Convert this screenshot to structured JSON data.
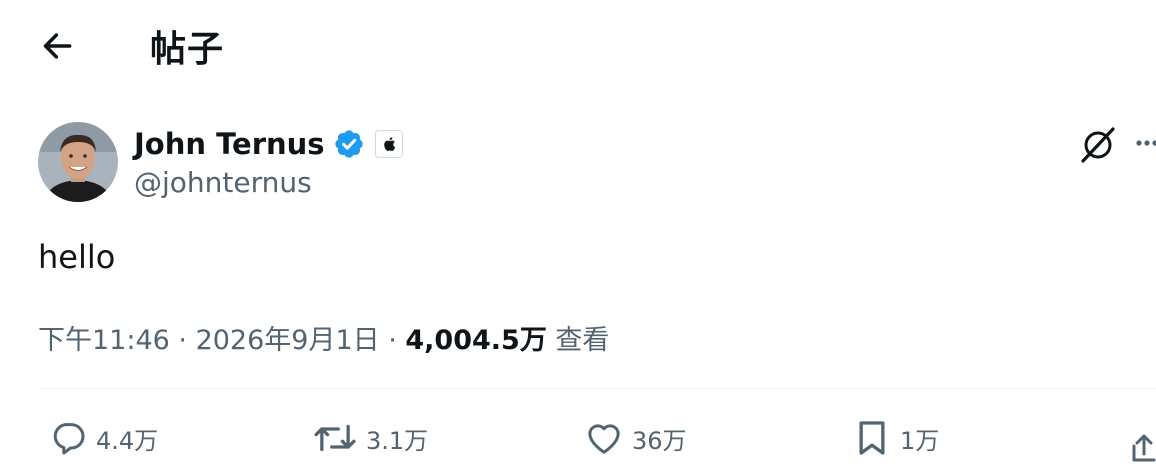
{
  "header": {
    "title": "帖子",
    "back_icon": "arrow-left-icon"
  },
  "author": {
    "name": "John Ternus",
    "handle": "@johnternus",
    "verified_color": "#1d9bf0",
    "affiliate_icon": "apple-icon"
  },
  "post": {
    "text": "hello",
    "time": "下午11:46",
    "sep1": " · ",
    "date": "2026年9月1日",
    "sep2": " · ",
    "views_count": "4,004.5万",
    "views_label": " 查看"
  },
  "actions": {
    "reply_count": "4.4万",
    "repost_count": "3.1万",
    "like_count": "36万",
    "bookmark_count": "1万"
  },
  "colors": {
    "text": "#0f1419",
    "secondary": "#536471",
    "accent": "#1d9bf0"
  }
}
